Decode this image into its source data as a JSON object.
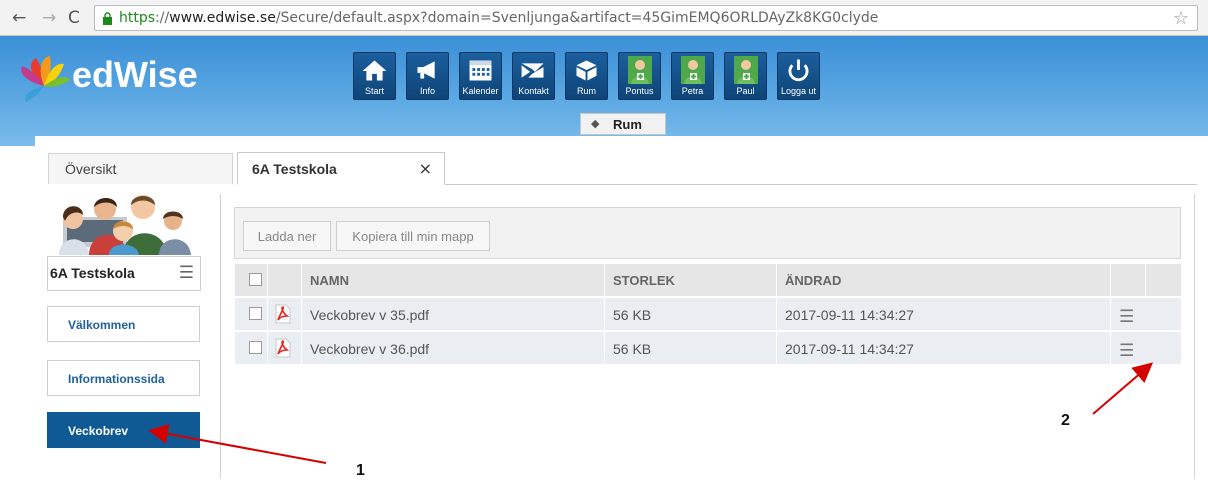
{
  "browser": {
    "url_https": "https",
    "url_sep": "://",
    "url_domain": "www.edwise.se",
    "url_path": "/Secure/default.aspx?domain=Svenljunga&artifact=45GimEMQ6ORLDAyZk8KG0clyde",
    "back_icon": "←",
    "forward_icon": "→",
    "reload_icon": "C",
    "star_icon": "☆"
  },
  "header": {
    "logo_text": "edWise",
    "nav": [
      {
        "label": "Start",
        "icon": "home-icon"
      },
      {
        "label": "Info",
        "icon": "megaphone-icon"
      },
      {
        "label": "Kalender",
        "icon": "calendar-icon"
      },
      {
        "label": "Kontakt",
        "icon": "envelope-icon"
      },
      {
        "label": "Rum",
        "icon": "cube-icon"
      },
      {
        "label": "Pontus",
        "icon": "user-icon"
      },
      {
        "label": "Petra",
        "icon": "user-icon"
      },
      {
        "label": "Paul",
        "icon": "user-icon"
      },
      {
        "label": "Logga ut",
        "icon": "power-icon"
      }
    ],
    "section_label": "Rum"
  },
  "tabs": {
    "overview": "Översikt",
    "active": "6A Testskola",
    "close": "×"
  },
  "sidebar": {
    "title": "6A Testskola",
    "items": [
      {
        "label": "Välkommen"
      },
      {
        "label": "Informationssida"
      },
      {
        "label": "Veckobrev",
        "active": true
      }
    ]
  },
  "toolbar": {
    "download_label": "Ladda ner",
    "copy_label": "Kopiera till min mapp"
  },
  "files": {
    "columns": [
      "NAMN",
      "STORLEK",
      "ÄNDRAD"
    ],
    "rows": [
      {
        "name": "Veckobrev v 35.pdf",
        "size": "56 KB",
        "modified": "2017-09-11 14:34:27"
      },
      {
        "name": "Veckobrev v 36.pdf",
        "size": "56 KB",
        "modified": "2017-09-11 14:34:27"
      }
    ]
  },
  "annotations": {
    "one": "1",
    "two": "2",
    "arrow_color": "#d40000"
  }
}
